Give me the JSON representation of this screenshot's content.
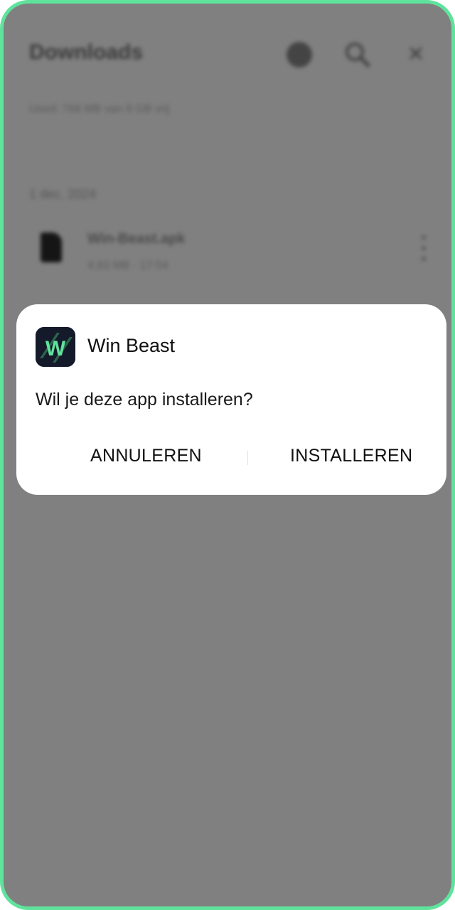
{
  "background": {
    "title": "Downloads",
    "storage_text": "Used: 768 MB van 8 GB vrij",
    "date_header": "1 dec. 2024",
    "file_name": "Win-Beast.apk",
    "file_meta": "4,63 MB · 17:54",
    "icons": [
      "gear-icon",
      "search-icon",
      "close-icon",
      "file-icon",
      "more-icon"
    ]
  },
  "dialog": {
    "app_name": "Win Beast",
    "question": "Wil je deze app installeren?",
    "cancel_label": "ANNULEREN",
    "install_label": "INSTALLEREN",
    "app_icon_letter": "W"
  },
  "colors": {
    "frame": "#5fe39c",
    "overlay": "#808080",
    "icon_bg": "#151a2a",
    "icon_accent": "#5fe39c"
  }
}
